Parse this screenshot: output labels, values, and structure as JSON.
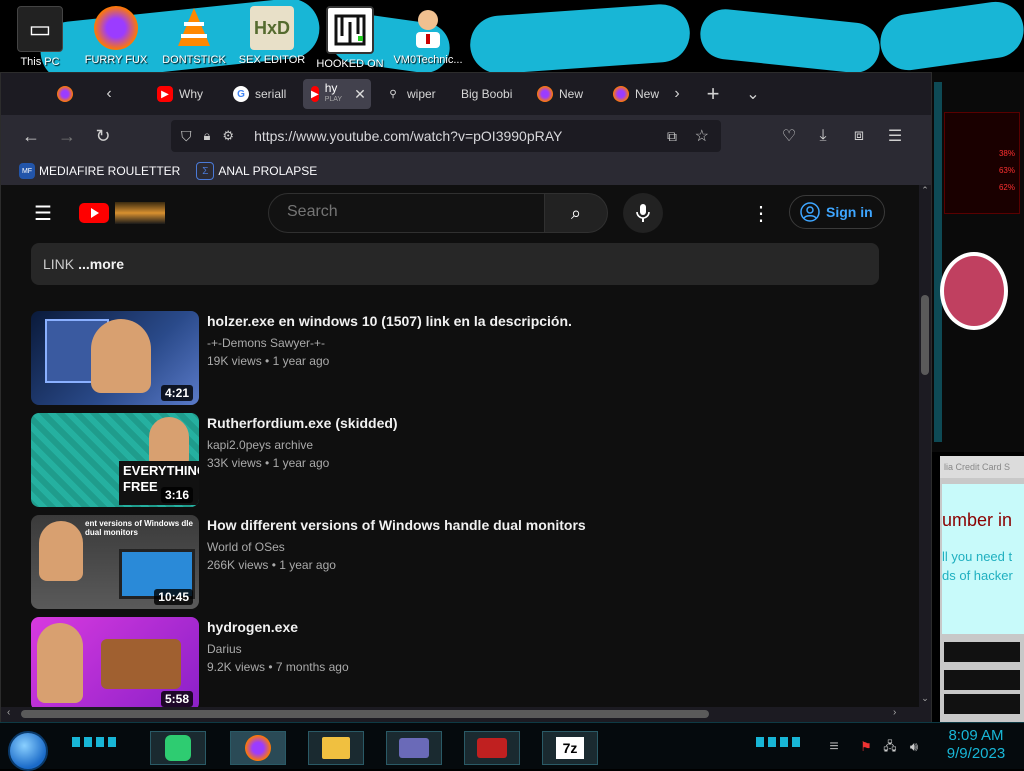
{
  "desktop": {
    "icons": [
      {
        "label": "This PC",
        "icon": "computer-icon"
      },
      {
        "label": "FURRY FUX",
        "icon": "firefox-icon"
      },
      {
        "label": "DONTSTICK",
        "icon": "vlc-cone-icon"
      },
      {
        "label": "SEX EDITOR",
        "icon": "hxd-editor-icon"
      },
      {
        "label": "HOOKED ON",
        "icon": "maze-app-icon"
      },
      {
        "label": "VM0Technic...",
        "icon": "doctor-avatar-icon"
      }
    ],
    "side_panel": {
      "percent_1": "38%",
      "percent_2": "63%",
      "percent_3": "62%",
      "window_title": "lia Credit Card S",
      "line_1": "umber in",
      "line_2": "ll you need t",
      "line_3": "ds of hacker"
    },
    "accent_color": "#18b6d6"
  },
  "browser": {
    "tabs": [
      {
        "label": "",
        "icon": "firefox-icon"
      },
      {
        "label": "Why",
        "icon": "youtube-icon"
      },
      {
        "label": "seriall",
        "icon": "google-icon"
      },
      {
        "label": "hy",
        "sub": "PLAY",
        "icon": "youtube-icon",
        "active": true
      },
      {
        "label": "wiper",
        "icon": "pin-icon"
      },
      {
        "label": "Big Boobi",
        "icon": ""
      },
      {
        "label": "New",
        "icon": "firefox-icon"
      },
      {
        "label": "New",
        "icon": "firefox-icon"
      }
    ],
    "url": "https://www.youtube.com/watch?v=pOI3990pRAY",
    "bookmarks": [
      {
        "label": "MEDIAFIRE ROULETTER",
        "icon": "mediafire-icon"
      },
      {
        "label": "ANAL PROLAPSE",
        "icon": "bookmark-folder-icon"
      }
    ]
  },
  "youtube": {
    "search_placeholder": "Search",
    "sign_in": "Sign in",
    "description_prefix": "LINK",
    "description_more": "...more",
    "videos": [
      {
        "title": "holzer.exe en windows 10 (1507) link en la descripción.",
        "channel": "-+-Demons Sawyer-+-",
        "views": "19K views",
        "age": "1 year ago",
        "duration": "4:21",
        "thumb_color": "#2a4a8a"
      },
      {
        "title": "Rutherfordium.exe (skidded)",
        "channel": "kapi2.0peys archive",
        "views": "33K views",
        "age": "1 year ago",
        "duration": "3:16",
        "thumb_color": "#1f9c8c",
        "thumb_text": "EVERYTHING FREE"
      },
      {
        "title": "How different versions of Windows handle dual monitors",
        "channel": "World of OSes",
        "views": "266K views",
        "age": "1 year ago",
        "duration": "10:45",
        "thumb_color": "#4a4a4a",
        "thumb_text": "ent versions of Windows dle dual monitors"
      },
      {
        "title": "hydrogen.exe",
        "channel": "Darius",
        "views": "9.2K views",
        "age": "7 months ago",
        "duration": "5:58",
        "thumb_color": "#b02ad8"
      }
    ]
  },
  "taskbar": {
    "apps": [
      {
        "name": "notes-app-icon"
      },
      {
        "name": "firefox-icon"
      },
      {
        "name": "file-explorer-icon"
      },
      {
        "name": "card-app-icon"
      },
      {
        "name": "media-app-icon"
      },
      {
        "name": "7zip-icon",
        "label": "7z"
      }
    ],
    "time": "8:09 AM",
    "date": "9/9/2023"
  }
}
